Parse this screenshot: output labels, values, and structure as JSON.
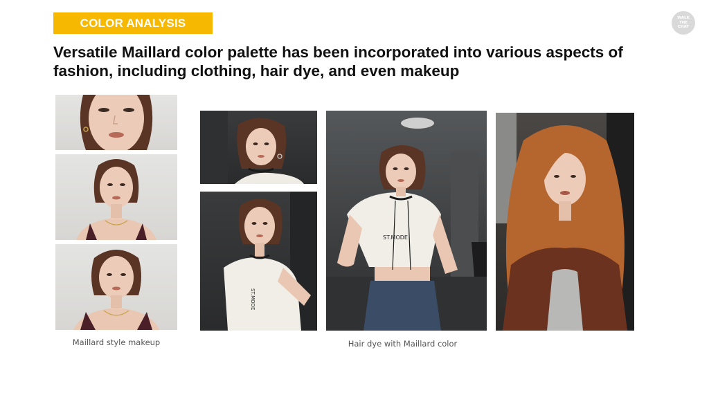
{
  "header": {
    "tag": "COLOR ANALYSIS",
    "title": "Versatile Maillard color palette has been incorporated into various aspects of fashion, including clothing, hair dye, and even makeup"
  },
  "logo": {
    "lines": [
      "WALK",
      "THE",
      "CHAT"
    ]
  },
  "captions": {
    "makeup": "Maillard style makeup",
    "hair_dye": "Hair dye with Maillard color"
  },
  "photos": {
    "tshirt_text": "ST.MODE",
    "colors": {
      "hair_brown": "#5a3525",
      "hair_auburn": "#b5652e",
      "skin": "#e9c7b2",
      "jacket": "#6b3220",
      "accent": "#f6b800"
    }
  }
}
